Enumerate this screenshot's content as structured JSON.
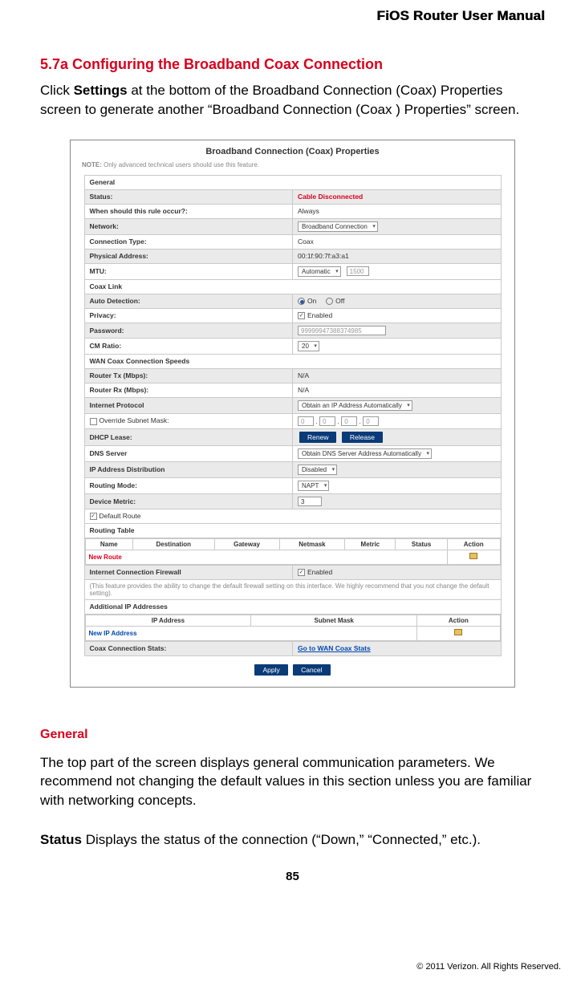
{
  "header": {
    "manual_title": "FiOS Router User Manual"
  },
  "section": {
    "num_title": "5.7a  Configuring the Broadband Coax Connection",
    "intro_prefix": "Click ",
    "intro_bold": "Settings",
    "intro_suffix": " at the bottom of the Broadband Connection (Coax) Properties screen to generate another “Broadband Connection (Coax ) Properties” screen."
  },
  "shot": {
    "title": "Broadband Connection (Coax) Properties",
    "note_prefix": "NOTE: ",
    "note_text": "Only advanced technical users should use this feature.",
    "rows": {
      "general": "General",
      "status_lbl": "Status:",
      "status_val": "Cable Disconnected",
      "rule_lbl": "When should this rule occur?:",
      "rule_val": "Always",
      "network_lbl": "Network:",
      "network_val": "Broadband Connection",
      "conntype_lbl": "Connection Type:",
      "conntype_val": "Coax",
      "phys_lbl": "Physical Address:",
      "phys_val": "00:1f:90:7f:a3:a1",
      "mtu_lbl": "MTU:",
      "mtu_drop": "Automatic",
      "mtu_num": "1500",
      "coaxlink": "Coax Link",
      "autodet_lbl": "Auto Detection:",
      "autodet_on": "On",
      "autodet_off": "Off",
      "privacy_lbl": "Privacy:",
      "privacy_val": "Enabled",
      "password_lbl": "Password:",
      "password_val": "99999947388374985",
      "cmratio_lbl": "CM Ratio:",
      "cmratio_val": "20",
      "wanspeeds": "WAN Coax Connection Speeds",
      "tx_lbl": "Router Tx (Mbps):",
      "tx_val": "N/A",
      "rx_lbl": "Router Rx (Mbps):",
      "rx_val": "N/A",
      "ip_lbl": "Internet Protocol",
      "ip_val": "Obtain an IP Address Automatically",
      "override_lbl": "Override Subnet Mask:",
      "oct": "0",
      "dhcplease_lbl": "DHCP Lease:",
      "renew_btn": "Renew",
      "release_btn": "Release",
      "dns_lbl": "DNS Server",
      "dns_val": "Obtain DNS Server Address Automatically",
      "ipdist_lbl": "IP Address Distribution",
      "ipdist_val": "Disabled",
      "routing_lbl": "Routing Mode:",
      "routing_val": "NAPT",
      "metric_lbl": "Device Metric:",
      "metric_val": "3",
      "defroute_lbl": "Default Route",
      "routingtable": "Routing Table",
      "rt_name": "Name",
      "rt_dest": "Destination",
      "rt_gw": "Gateway",
      "rt_mask": "Netmask",
      "rt_metric": "Metric",
      "rt_status": "Status",
      "rt_action": "Action",
      "newroute": "New Route",
      "fw_lbl": "Internet Connection Firewall",
      "fw_val": "Enabled",
      "fw_note": "(This feature provides the ability to change the default firewall setting on this interface. We highly recommend that you not change the default setting).",
      "addip_hdr": "Additional IP Addresses",
      "addip_col_ip": "IP Address",
      "addip_col_mask": "Subnet Mask",
      "addip_col_action": "Action",
      "newipaddr": "New IP Address",
      "stats_lbl": "Coax Connection Stats:",
      "stats_link": "Go to WAN Coax Stats",
      "apply_btn": "Apply",
      "cancel_btn": "Cancel"
    }
  },
  "lower": {
    "heading": "General",
    "para": "The top part of the screen displays general communication parameters. We recommend not changing the default values in this section unless you are familiar with networking concepts.",
    "status_bold": "Status",
    "status_rest": "  Displays the status of the connection (“Down,” “Connected,” etc.)."
  },
  "footer": {
    "page": "85",
    "copyright": "© 2011 Verizon. All Rights Reserved."
  }
}
